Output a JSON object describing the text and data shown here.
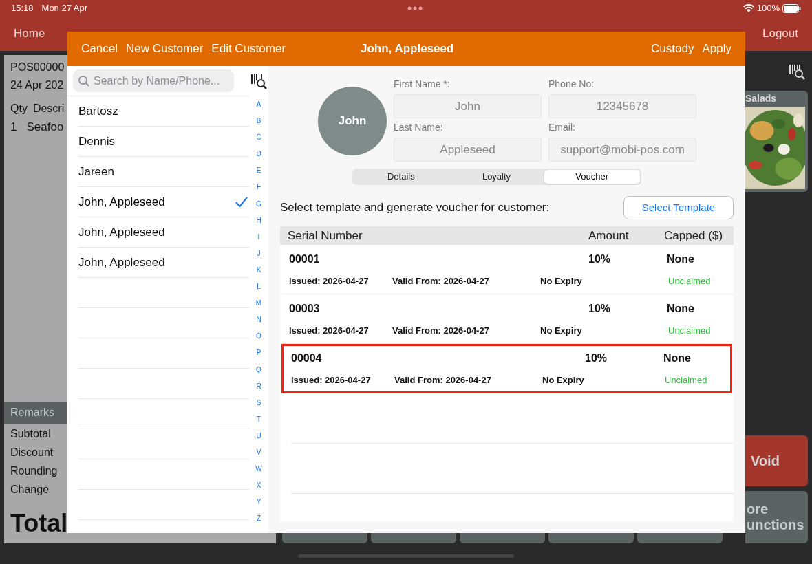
{
  "status_bar": {
    "time": "15:18",
    "date": "Mon 27 Apr",
    "battery": "100%"
  },
  "nav": [
    "Home",
    "Logout"
  ],
  "receipt": {
    "id": "POS00000",
    "date": "24 Apr 202",
    "columns": [
      "Qty",
      "Descri"
    ],
    "line": {
      "qty": "1",
      "description": "Seafoo"
    },
    "remarks": "Remarks",
    "summary": [
      "Subtotal",
      "Discount",
      "Rounding",
      "Change"
    ],
    "total_label": "Total"
  },
  "side": {
    "category": "Salads",
    "void": "Void",
    "more": [
      "ore",
      "unctions"
    ]
  },
  "dialog": {
    "left_actions": [
      "Cancel",
      "New Customer",
      "Edit Customer"
    ],
    "title": "John, Appleseed",
    "right_actions": [
      "Custody",
      "Apply"
    ],
    "search": {
      "placeholder": "Search by Name/Phone..."
    },
    "customers": [
      {
        "name": "Bartosz",
        "selected": false
      },
      {
        "name": "Dennis",
        "selected": false
      },
      {
        "name": "Jareen",
        "selected": false
      },
      {
        "name": "John, Appleseed",
        "selected": true
      },
      {
        "name": "John, Appleseed",
        "selected": false
      },
      {
        "name": "John, Appleseed",
        "selected": false
      }
    ],
    "index": [
      "A",
      "B",
      "C",
      "D",
      "E",
      "F",
      "G",
      "H",
      "I",
      "J",
      "K",
      "L",
      "M",
      "N",
      "O",
      "P",
      "Q",
      "R",
      "S",
      "T",
      "U",
      "V",
      "W",
      "X",
      "Y",
      "Z"
    ],
    "avatar": "John",
    "fields": [
      {
        "label": "First Name *:",
        "value": "John"
      },
      {
        "label": "Phone No:",
        "value": "12345678"
      },
      {
        "label": "Last Name:",
        "value": "Appleseed"
      },
      {
        "label": "Email:",
        "value": "support@mobi-pos.com"
      }
    ],
    "tabs": [
      {
        "label": "Details",
        "selected": false
      },
      {
        "label": "Loyalty",
        "selected": false
      },
      {
        "label": "Voucher",
        "selected": true
      }
    ],
    "prompt": "Select template and generate voucher for customer:",
    "select_template": "Select Template",
    "table": {
      "columns": [
        "Serial Number",
        "Amount",
        "Capped ($)"
      ],
      "rows": [
        {
          "serial": "00001",
          "amount": "10%",
          "capped": "None",
          "issued": "Issued: 2026-04-27",
          "valid_from": "Valid From: 2026-04-27",
          "expiry": "No Expiry",
          "status": "Unclaimed",
          "selected": false
        },
        {
          "serial": "00003",
          "amount": "10%",
          "capped": "None",
          "issued": "Issued: 2026-04-27",
          "valid_from": "Valid From: 2026-04-27",
          "expiry": "No Expiry",
          "status": "Unclaimed",
          "selected": false
        },
        {
          "serial": "00004",
          "amount": "10%",
          "capped": "None",
          "issued": "Issued: 2026-04-27",
          "valid_from": "Valid From: 2026-04-27",
          "expiry": "No Expiry",
          "status": "Unclaimed",
          "selected": true
        }
      ]
    }
  }
}
